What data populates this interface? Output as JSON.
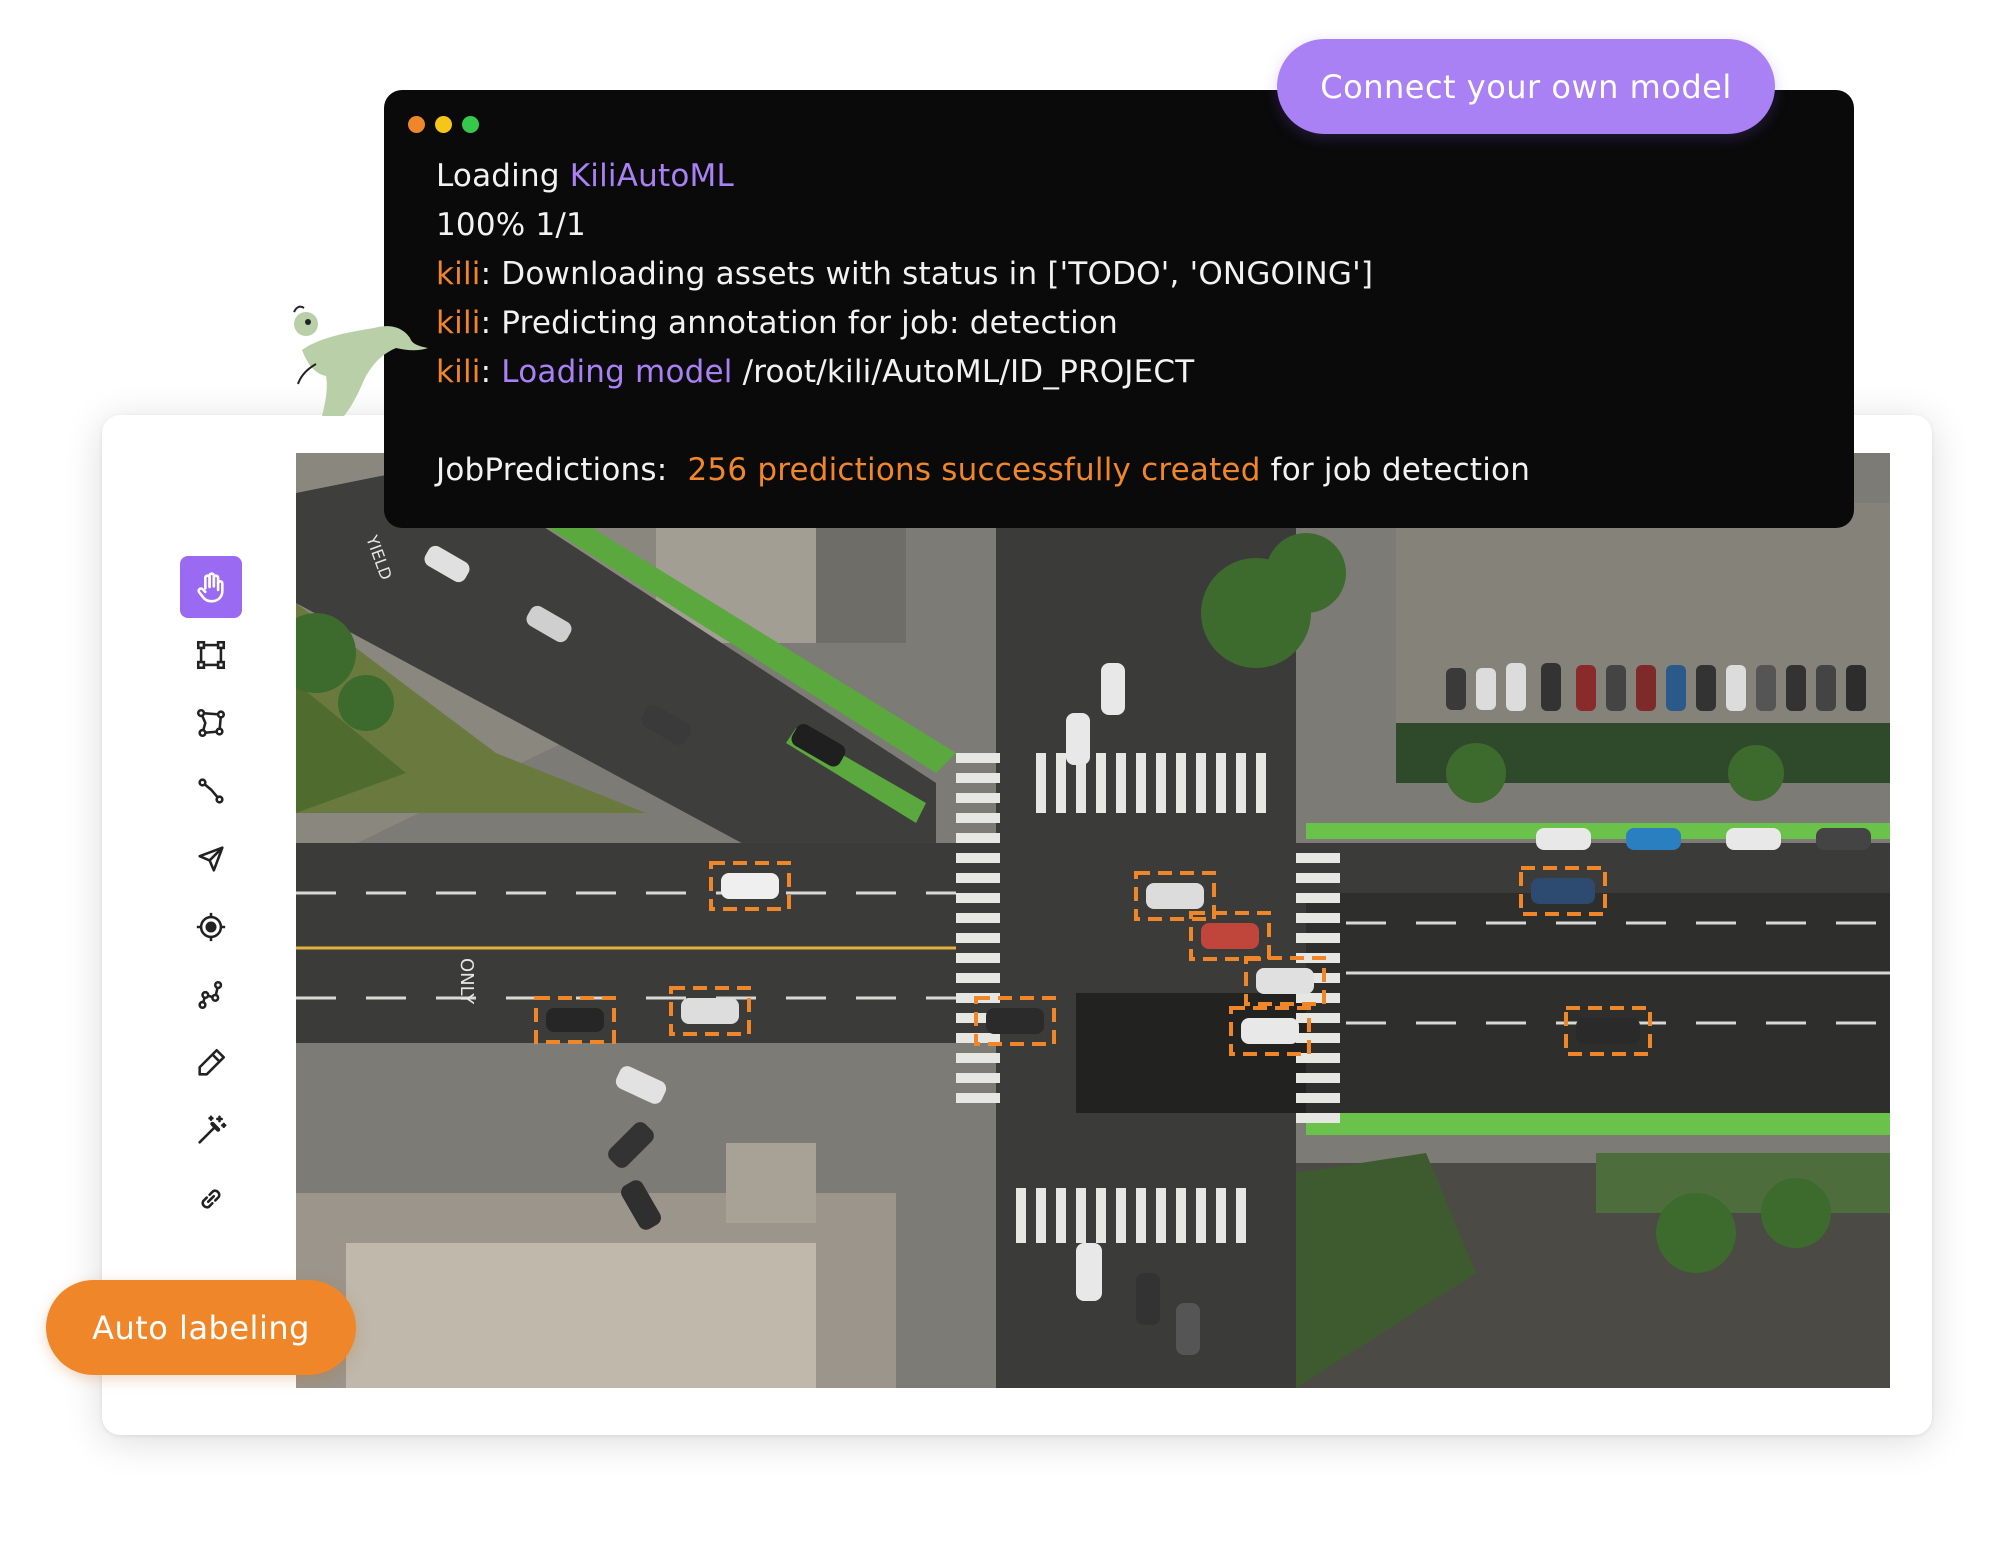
{
  "buttons": {
    "connect_model": "Connect your own model",
    "auto_labeling": "Auto labeling"
  },
  "terminal": {
    "window_dot_colors": [
      "#f0862a",
      "#f5c518",
      "#35c84a"
    ],
    "line1": {
      "prefix": "Loading ",
      "highlight": "KiliAutoML"
    },
    "line2": {
      "text": "100% 1/1"
    },
    "line3": {
      "tag": "kili",
      "text": ": Downloading assets with status in ['TODO', 'ONGOING']"
    },
    "line4": {
      "tag": "kili",
      "text": ": Predicting annotation for job: detection"
    },
    "line5": {
      "tag": "kili",
      "sep": ": ",
      "highlight": "Loading model",
      "text": " /root/kili/AutoML/ID_PROJECT"
    },
    "line6": {
      "prefix": "JobPredictions:  ",
      "highlight": "256 predictions successfully created",
      "suffix": " for job detection"
    }
  },
  "toolbar": {
    "tools": [
      {
        "name": "pan",
        "icon": "hand-icon",
        "active": true
      },
      {
        "name": "bounding-box",
        "icon": "bounding-box-icon",
        "active": false
      },
      {
        "name": "polygon",
        "icon": "polygon-icon",
        "active": false
      },
      {
        "name": "line",
        "icon": "polyline-icon",
        "active": false
      },
      {
        "name": "vector",
        "icon": "arrow-icon",
        "active": false
      },
      {
        "name": "point",
        "icon": "target-icon",
        "active": false
      },
      {
        "name": "pose",
        "icon": "pose-icon",
        "active": false
      },
      {
        "name": "brush",
        "icon": "pen-icon",
        "active": false
      },
      {
        "name": "magic-wand",
        "icon": "magic-wand-icon",
        "active": false
      },
      {
        "name": "link",
        "icon": "link-icon",
        "active": false
      }
    ]
  },
  "colors": {
    "accent_purple": "#a981f5",
    "accent_orange": "#f0862a",
    "active_tool": "#9a6af2",
    "terminal_bg": "#0a0a0a",
    "bbox_stroke": "#f0862a"
  },
  "image": {
    "road_markings": [
      "ONLY",
      "YIELD"
    ]
  }
}
